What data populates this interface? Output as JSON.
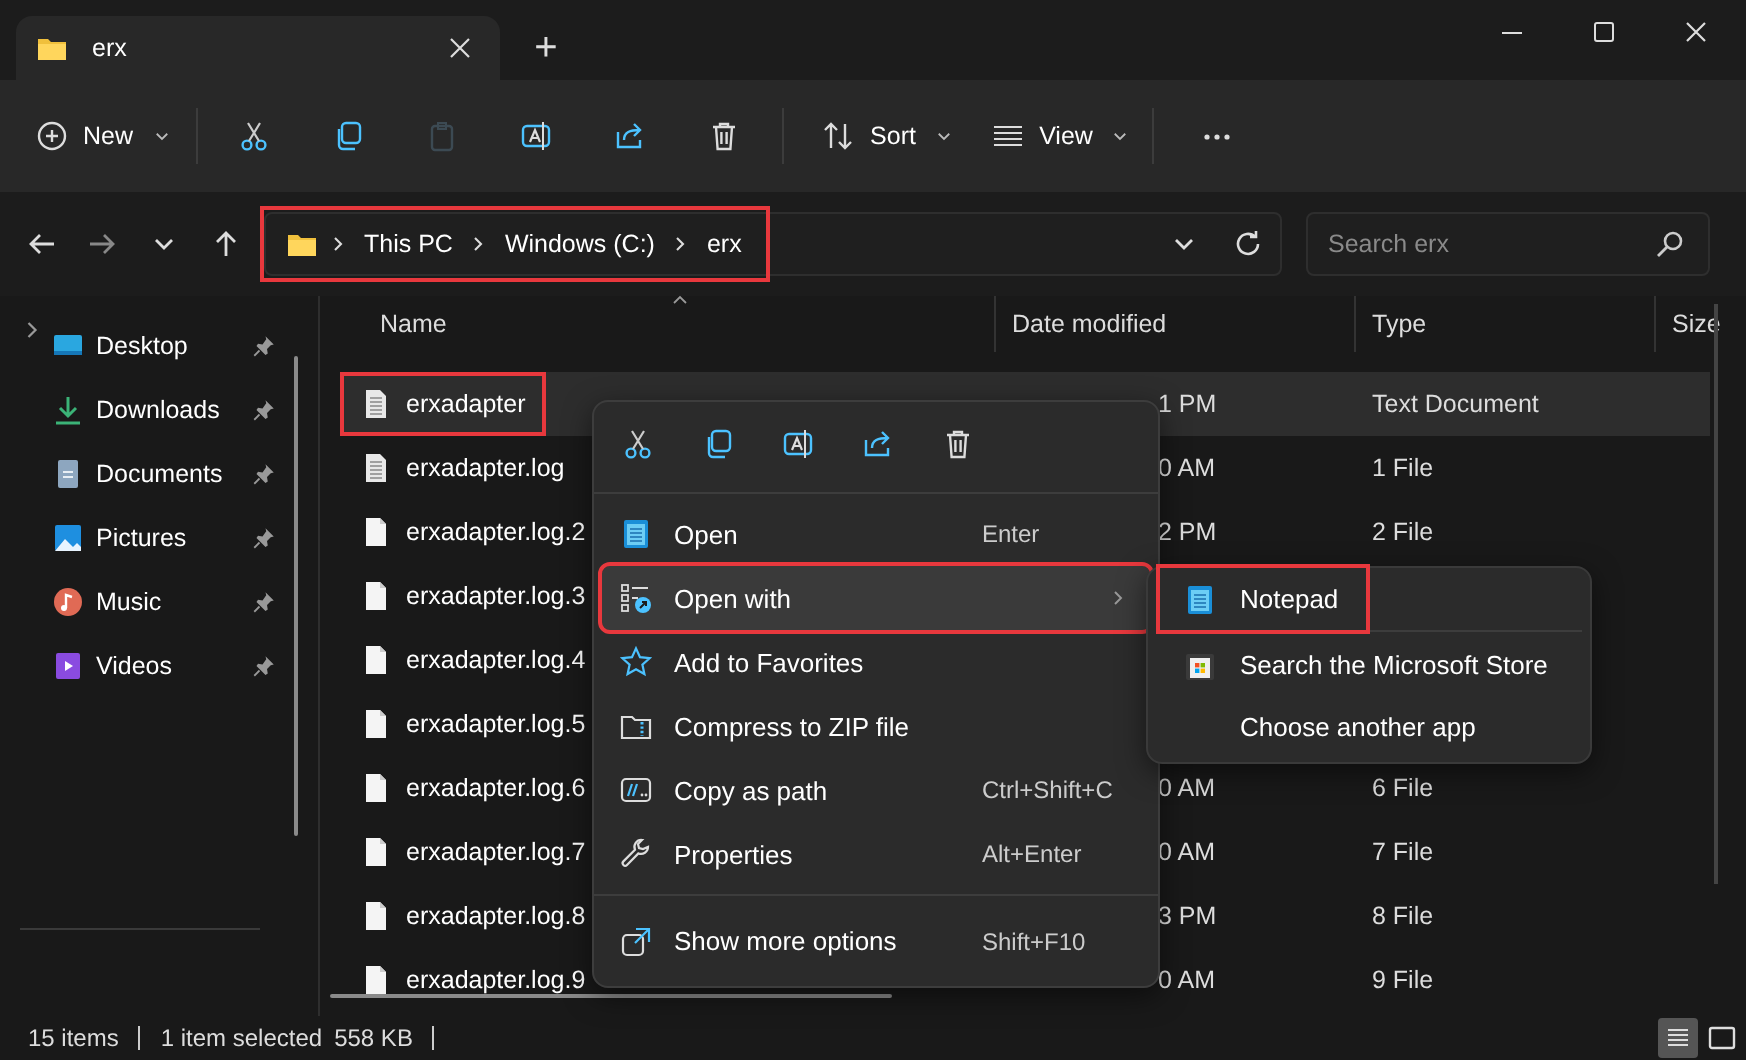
{
  "tabs": [
    {
      "label": "erx",
      "selected": true
    }
  ],
  "new_tab": "+",
  "toolbar": [
    {
      "kind": "new",
      "label": "New",
      "disabled": false
    },
    {
      "kind": "cut",
      "disabled": false
    },
    {
      "kind": "copy",
      "disabled": false
    },
    {
      "kind": "paste",
      "disabled": true
    },
    {
      "kind": "rename",
      "disabled": false
    },
    {
      "kind": "share",
      "disabled": false
    },
    {
      "kind": "delete",
      "disabled": false
    },
    {
      "kind": "sort",
      "label": "Sort",
      "disabled": false
    },
    {
      "kind": "view",
      "label": "View",
      "disabled": false
    },
    {
      "kind": "more",
      "disabled": false
    }
  ],
  "address": {
    "crumbs": [
      "This PC",
      "Windows (C:)",
      "erx"
    ],
    "highlighted": true
  },
  "search": {
    "placeholder": "Search erx"
  },
  "sidebar": {
    "items": [
      {
        "kind": "desktop",
        "label": "Desktop",
        "pinned": true
      },
      {
        "kind": "downloads",
        "label": "Downloads",
        "pinned": true
      },
      {
        "kind": "documents",
        "label": "Documents",
        "pinned": true
      },
      {
        "kind": "pictures",
        "label": "Pictures",
        "pinned": true
      },
      {
        "kind": "music",
        "label": "Music",
        "pinned": true
      },
      {
        "kind": "videos",
        "label": "Videos",
        "pinned": true
      }
    ]
  },
  "columns": [
    "Name",
    "Date modified",
    "Type",
    "Size"
  ],
  "rows": [
    {
      "kind": "text",
      "name": "erxadapter",
      "date": "1 PM",
      "type": "Text Document",
      "selected": true,
      "highlighted": true
    },
    {
      "kind": "text",
      "name": "erxadapter.log",
      "date": "0 AM",
      "type": "1 File",
      "selected": false,
      "highlighted": false
    },
    {
      "kind": "blank",
      "name": "erxadapter.log.2",
      "date": "2 PM",
      "type": "2 File",
      "selected": false,
      "highlighted": false
    },
    {
      "kind": "blank",
      "name": "erxadapter.log.3",
      "selected": false,
      "highlighted": false
    },
    {
      "kind": "blank",
      "name": "erxadapter.log.4",
      "selected": false,
      "highlighted": false
    },
    {
      "kind": "blank",
      "name": "erxadapter.log.5",
      "selected": false,
      "highlighted": false
    },
    {
      "kind": "blank",
      "name": "erxadapter.log.6",
      "date": "0 AM",
      "type": "6 File",
      "selected": false,
      "highlighted": false
    },
    {
      "kind": "blank",
      "name": "erxadapter.log.7",
      "date": "0 AM",
      "type": "7 File",
      "selected": false,
      "highlighted": false
    },
    {
      "kind": "blank",
      "name": "erxadapter.log.8",
      "date": "3 PM",
      "type": "8 File",
      "selected": false,
      "highlighted": false
    },
    {
      "kind": "blank",
      "name": "erxadapter.log.9",
      "date": "0 AM",
      "type": "9 File",
      "selected": false,
      "highlighted": false
    }
  ],
  "context_menu": {
    "actions": [
      {
        "kind": "cut"
      },
      {
        "kind": "copy"
      },
      {
        "kind": "rename"
      },
      {
        "kind": "share"
      },
      {
        "kind": "delete"
      }
    ],
    "items": [
      {
        "kind": "open",
        "label": "Open",
        "shortcut": "Enter",
        "hovered": false,
        "highlighted": false
      },
      {
        "kind": "open_with",
        "label": "Open with",
        "submenu": true,
        "hovered": true,
        "highlighted": true
      },
      {
        "kind": "favorite",
        "label": "Add to Favorites",
        "hovered": false,
        "highlighted": false
      },
      {
        "kind": "zip",
        "label": "Compress to ZIP file",
        "hovered": false,
        "highlighted": false
      },
      {
        "kind": "path",
        "label": "Copy as path",
        "shortcut": "Ctrl+Shift+C",
        "hovered": false,
        "highlighted": false
      },
      {
        "kind": "properties",
        "label": "Properties",
        "shortcut": "Alt+Enter",
        "hovered": false,
        "highlighted": false
      },
      {
        "kind": "more",
        "label": "Show more options",
        "shortcut": "Shift+F10",
        "hovered": false,
        "highlighted": false,
        "separated": true
      }
    ]
  },
  "submenu": {
    "items": [
      {
        "kind": "notepad",
        "label": "Notepad",
        "highlighted": true
      },
      {
        "kind": "store",
        "label": "Search the Microsoft Store",
        "highlighted": false
      },
      {
        "kind": "none",
        "label": "Choose another app",
        "highlighted": false
      }
    ]
  },
  "status_bar": {
    "count": "15 items",
    "selection": "1 item selected",
    "size": "558 KB"
  },
  "view_modes": [
    {
      "kind": "details",
      "selected": true
    },
    {
      "kind": "tiles",
      "selected": false
    }
  ]
}
